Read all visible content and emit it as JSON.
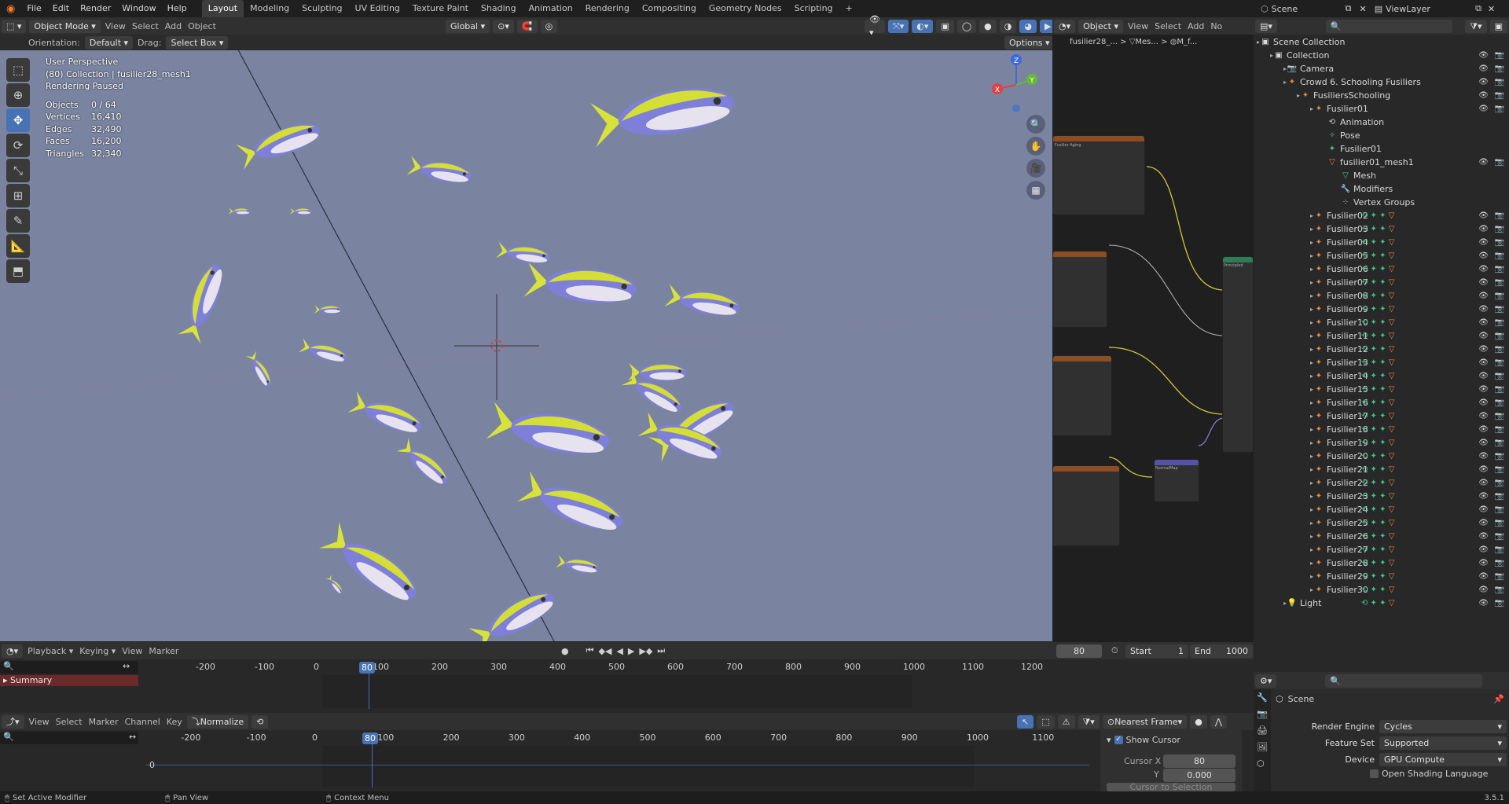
{
  "menu": {
    "file": "File",
    "edit": "Edit",
    "render": "Render",
    "window": "Window",
    "help": "Help"
  },
  "workspaces": [
    "Layout",
    "Modeling",
    "Sculpting",
    "UV Editing",
    "Texture Paint",
    "Shading",
    "Animation",
    "Rendering",
    "Compositing",
    "Geometry Nodes",
    "Scripting"
  ],
  "scene_name": "Scene",
  "view_layer": "ViewLayer",
  "viewport_header": {
    "mode": "Object Mode",
    "view": "View",
    "select": "Select",
    "add": "Add",
    "object": "Object",
    "transform": "Global"
  },
  "tool_settings": {
    "orientation_label": "Orientation:",
    "orientation": "Default",
    "drag_label": "Drag:",
    "drag": "Select Box",
    "options": "Options"
  },
  "overlay": {
    "perspective": "User Perspective",
    "collection": "(80) Collection | fusilier28_mesh1",
    "render_status": "Rendering Paused",
    "stats": [
      {
        "k": "Objects",
        "v": "0 / 64"
      },
      {
        "k": "Vertices",
        "v": "16,410"
      },
      {
        "k": "Edges",
        "v": "32,490"
      },
      {
        "k": "Faces",
        "v": "16,200"
      },
      {
        "k": "Triangles",
        "v": "32,340"
      }
    ]
  },
  "gizmo": {
    "x": "X",
    "y": "Y",
    "z": "Z"
  },
  "node_editor": {
    "type": "Object",
    "view": "View",
    "select": "Select",
    "add": "Add",
    "node": "No",
    "breadcrumb": [
      "fusilier28_...",
      "Mes...",
      "M_f..."
    ],
    "node_titles": [
      "Fusilier Aging",
      "",
      "",
      "",
      "NormalMap",
      "Principled"
    ]
  },
  "outliner": {
    "rows": [
      {
        "label": "Scene Collection",
        "indent": 0,
        "icon": "collection-icon"
      },
      {
        "label": "Collection",
        "indent": 1,
        "icon": "collection-icon"
      },
      {
        "label": "Camera",
        "indent": 2,
        "icon": "camera-icon"
      },
      {
        "label": "Crowd 6. Schooling Fusiliers",
        "indent": 2,
        "icon": "armature-icon"
      },
      {
        "label": "FusiliersSchooling",
        "indent": 3,
        "icon": "armature-icon"
      },
      {
        "label": "Fusilier01",
        "indent": 4,
        "icon": "armature-icon"
      },
      {
        "label": "Animation",
        "indent": 5,
        "icon": "animation-icon"
      },
      {
        "label": "Pose",
        "indent": 5,
        "icon": "pose-icon"
      },
      {
        "label": "Fusilier01",
        "indent": 5,
        "icon": "armature-data-icon"
      },
      {
        "label": "fusilier01_mesh1",
        "indent": 5,
        "icon": "mesh-icon"
      },
      {
        "label": "Mesh",
        "indent": 6,
        "icon": "mesh-data-icon"
      },
      {
        "label": "Modifiers",
        "indent": 6,
        "icon": "modifier-icon"
      },
      {
        "label": "Vertex Groups",
        "indent": 6,
        "icon": "vertex-groups-icon"
      },
      {
        "label": "Fusilier02",
        "indent": 4,
        "icon": "armature-icon"
      },
      {
        "label": "Fusilier03",
        "indent": 4,
        "icon": "armature-icon"
      },
      {
        "label": "Fusilier04",
        "indent": 4,
        "icon": "armature-icon"
      },
      {
        "label": "Fusilier05",
        "indent": 4,
        "icon": "armature-icon"
      },
      {
        "label": "Fusilier06",
        "indent": 4,
        "icon": "armature-icon"
      },
      {
        "label": "Fusilier07",
        "indent": 4,
        "icon": "armature-icon"
      },
      {
        "label": "Fusilier08",
        "indent": 4,
        "icon": "armature-icon"
      },
      {
        "label": "Fusilier09",
        "indent": 4,
        "icon": "armature-icon"
      },
      {
        "label": "Fusilier10",
        "indent": 4,
        "icon": "armature-icon"
      },
      {
        "label": "Fusilier11",
        "indent": 4,
        "icon": "armature-icon"
      },
      {
        "label": "Fusilier12",
        "indent": 4,
        "icon": "armature-icon"
      },
      {
        "label": "Fusilier13",
        "indent": 4,
        "icon": "armature-icon"
      },
      {
        "label": "Fusilier14",
        "indent": 4,
        "icon": "armature-icon"
      },
      {
        "label": "Fusilier15",
        "indent": 4,
        "icon": "armature-icon"
      },
      {
        "label": "Fusilier16",
        "indent": 4,
        "icon": "armature-icon"
      },
      {
        "label": "Fusilier17",
        "indent": 4,
        "icon": "armature-icon"
      },
      {
        "label": "Fusilier18",
        "indent": 4,
        "icon": "armature-icon"
      },
      {
        "label": "Fusilier19",
        "indent": 4,
        "icon": "armature-icon"
      },
      {
        "label": "Fusilier20",
        "indent": 4,
        "icon": "armature-icon"
      },
      {
        "label": "Fusilier21",
        "indent": 4,
        "icon": "armature-icon"
      },
      {
        "label": "Fusilier22",
        "indent": 4,
        "icon": "armature-icon"
      },
      {
        "label": "Fusilier23",
        "indent": 4,
        "icon": "armature-icon"
      },
      {
        "label": "Fusilier24",
        "indent": 4,
        "icon": "armature-icon"
      },
      {
        "label": "Fusilier25",
        "indent": 4,
        "icon": "armature-icon"
      },
      {
        "label": "Fusilier26",
        "indent": 4,
        "icon": "armature-icon"
      },
      {
        "label": "Fusilier27",
        "indent": 4,
        "icon": "armature-icon"
      },
      {
        "label": "Fusilier28",
        "indent": 4,
        "icon": "armature-icon"
      },
      {
        "label": "Fusilier29",
        "indent": 4,
        "icon": "armature-icon"
      },
      {
        "label": "Fusilier30",
        "indent": 4,
        "icon": "armature-icon"
      },
      {
        "label": "Light",
        "indent": 2,
        "icon": "light-icon"
      }
    ]
  },
  "timeline": {
    "playback": "Playback",
    "keying": "Keying",
    "view": "View",
    "marker": "Marker",
    "current_frame": "80",
    "start_label": "Start",
    "start": "1",
    "end_label": "End",
    "end": "1000",
    "ticks": [
      "-200",
      "-100",
      "0",
      "100",
      "200",
      "300",
      "400",
      "500",
      "600",
      "700",
      "800",
      "900",
      "1000",
      "1100",
      "1200"
    ],
    "summary": "Summary"
  },
  "graph_editor": {
    "view": "View",
    "select": "Select",
    "marker": "Marker",
    "channel": "Channel",
    "key": "Key",
    "normalize": "Normalize",
    "pivot": "Nearest Frame",
    "current_frame": "80",
    "ticks": [
      "-200",
      "-100",
      "0",
      "100",
      "200",
      "300",
      "400",
      "500",
      "600",
      "700",
      "800",
      "900",
      "1000",
      "1100"
    ],
    "y_tick": "0",
    "show_cursor": "Show Cursor",
    "cursor_x_label": "Cursor X",
    "cursor_x": "80",
    "cursor_y_label": "Y",
    "cursor_y": "0.000",
    "cursor_to_selection": "Cursor to Selection"
  },
  "properties": {
    "scene": "Scene",
    "render_engine_label": "Render Engine",
    "render_engine": "Cycles",
    "feature_set_label": "Feature Set",
    "feature_set": "Supported",
    "device_label": "Device",
    "device": "GPU Compute",
    "osl": "Open Shading Language"
  },
  "status": {
    "left": "Set Active Modifier",
    "mid": "Pan View",
    "right": "Context Menu",
    "version": "3.5.1"
  },
  "colors": {
    "accent": "#4772b3",
    "viewport_bg": "#7a84a1",
    "orange": "#e8893c",
    "green": "#3fc48b"
  }
}
